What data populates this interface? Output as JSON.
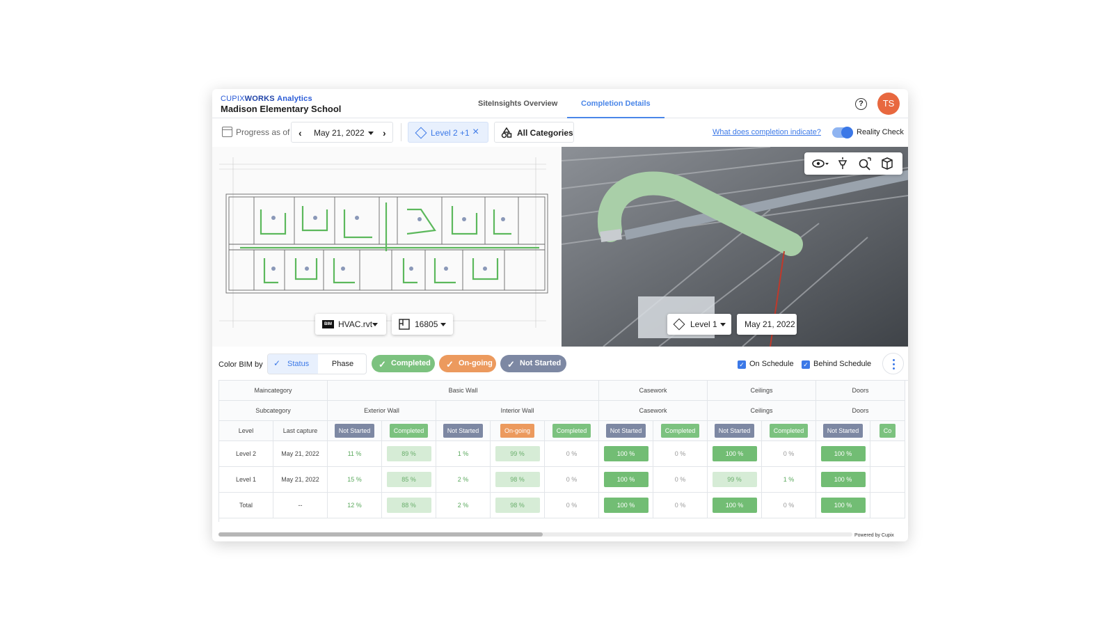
{
  "header": {
    "brand_prefix": "CUPIX",
    "brand_bold": "WORKS",
    "brand_suffix": "Analytics",
    "project": "Madison Elementary School",
    "tabs": [
      {
        "label": "SiteInsights Overview",
        "active": false
      },
      {
        "label": "Completion Details",
        "active": true
      }
    ],
    "help_icon": "?",
    "avatar": "TS"
  },
  "toolbar": {
    "progress_label": "Progress as of",
    "date": "May 21, 2022",
    "level_filter": "Level 2 +1",
    "category": "All Categories",
    "help_link": "What does completion indicate?",
    "reality_check": "Reality Check",
    "reality_check_on": true
  },
  "plan_view": {
    "bim_badge": "BIM",
    "model_file": "HVAC.rvt",
    "sheet": "16805"
  },
  "photo_view": {
    "level": "Level 1",
    "date": "May 21, 2022",
    "tools": [
      "eye-icon",
      "light-icon",
      "search-zoom-icon",
      "box-icon"
    ]
  },
  "filters": {
    "color_by_label": "Color BIM by",
    "segments": [
      "Status",
      "Phase"
    ],
    "active_segment": "Status",
    "chips": [
      {
        "label": "Completed",
        "color": "#7cc27f"
      },
      {
        "label": "On-going",
        "color": "#ec9a5e"
      },
      {
        "label": "Not Started",
        "color": "#7d88a3"
      }
    ],
    "checkboxes": [
      {
        "label": "On Schedule",
        "checked": true
      },
      {
        "label": "Behind Schedule",
        "checked": true
      }
    ]
  },
  "table": {
    "maincategory_label": "Maincategory",
    "subcategory_label": "Subcategory",
    "level_label": "Level",
    "last_capture_label": "Last capture",
    "maincategories": [
      "Basic Wall",
      "Casework",
      "Ceilings",
      "Doors"
    ],
    "subcategories": [
      "Exterior Wall",
      "Interior Wall",
      "Casework",
      "Ceilings",
      "Doors"
    ],
    "status_headers": [
      "Not Started",
      "Completed",
      "Not Started",
      "On-going",
      "Completed",
      "Not Started",
      "Completed",
      "Not Started",
      "Completed",
      "Not Started",
      "Co"
    ],
    "rows": [
      {
        "level": "Level 2",
        "capture": "May 21, 2022",
        "values": [
          "11 %",
          "89 %",
          "1 %",
          "99 %",
          "0 %",
          "100 %",
          "0 %",
          "100 %",
          "0 %",
          "100 %"
        ]
      },
      {
        "level": "Level 1",
        "capture": "May 21, 2022",
        "values": [
          "15 %",
          "85 %",
          "2 %",
          "98 %",
          "0 %",
          "100 %",
          "0 %",
          "99 %",
          "1 %",
          "100 %"
        ]
      },
      {
        "level": "Total",
        "capture": "--",
        "values": [
          "12 %",
          "88 %",
          "2 %",
          "98 %",
          "0 %",
          "100 %",
          "0 %",
          "100 %",
          "0 %",
          "100 %"
        ]
      }
    ]
  },
  "footer": {
    "powered_by": "Powered by Cupix"
  }
}
